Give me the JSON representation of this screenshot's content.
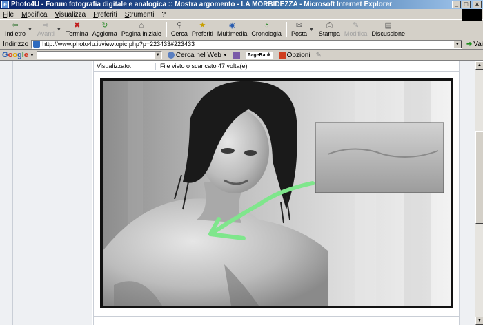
{
  "window": {
    "title": "Photo4U - Forum fotografia digitale e analogica :: Mostra argomento - LA MORBIDEZZA - Microsoft Internet Explorer"
  },
  "menu": [
    "File",
    "Modifica",
    "Visualizza",
    "Preferiti",
    "Strumenti",
    "?"
  ],
  "toolbar": {
    "back": "Indietro",
    "forward": "Avanti",
    "stop": "Termina",
    "refresh": "Aggiorna",
    "home": "Pagina iniziale",
    "search": "Cerca",
    "favorites": "Preferiti",
    "media": "Multimedia",
    "history": "Cronologia",
    "mail": "Posta",
    "print": "Stampa",
    "edit": "Modifica",
    "discuss": "Discussione"
  },
  "address": {
    "label": "Indirizzo",
    "url": "http://www.photo4u.it/viewtopic.php?p=223433#223433",
    "go": "Vai"
  },
  "google": {
    "logo": "Google",
    "search_web": "Cerca nel Web",
    "pagerank": "PageRank",
    "options": "Opzioni"
  },
  "post": {
    "viewed_label": "Visualizzato:",
    "viewed_value": "File visto o scaricato 47 volta(e)"
  },
  "icons": {
    "back": "back-arrow-icon",
    "forward": "forward-arrow-icon",
    "stop": "stop-icon",
    "refresh": "refresh-icon",
    "home": "home-icon",
    "search": "search-icon",
    "favorites": "favorites-star-icon",
    "media": "media-icon",
    "history": "history-icon",
    "mail": "mail-icon",
    "print": "print-icon",
    "edit": "edit-icon",
    "discuss": "discuss-icon"
  },
  "colors": {
    "title_gradient_start": "#0a246a",
    "arrow_annotation": "#7fe68c",
    "chrome": "#d4d0c8"
  }
}
